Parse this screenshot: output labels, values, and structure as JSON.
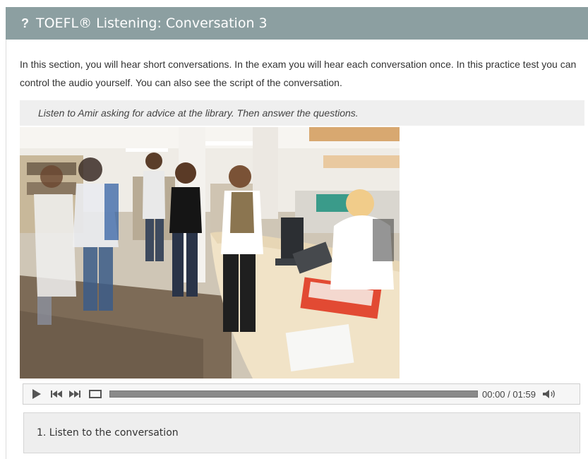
{
  "header": {
    "icon": "question-mark-icon",
    "icon_glyph": "?",
    "title": "TOEFL® Listening: Conversation 3",
    "background": "#8c9fa1"
  },
  "intro": {
    "text": "In this section, you will hear short conversations. In the exam you will hear each conversation once. In this practice test you can control the audio yourself. You can also see the script of the conversation."
  },
  "instruction": {
    "text": "Listen to Amir asking for advice at the library. Then answer the questions."
  },
  "photo": {
    "description_icon": "library-photo"
  },
  "player": {
    "play_icon": "play-icon",
    "prev_icon": "skip-back-icon",
    "next_icon": "skip-forward-icon",
    "loop_icon": "repeat-icon",
    "volume_icon": "volume-icon",
    "current_time": "00:00",
    "separator": " / ",
    "total_time": "01:59",
    "progress_fraction": 0
  },
  "questions": {
    "first_label": "1. Listen to the conversation"
  }
}
